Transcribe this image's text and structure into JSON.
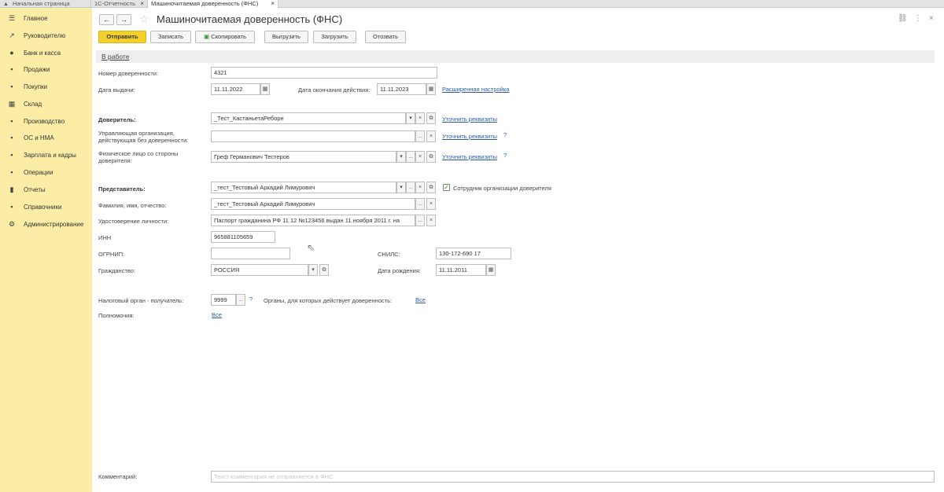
{
  "tabs": {
    "home": "Начальная страница",
    "reporting": "1С-Отчетность",
    "active": "Машиночитаемая доверенность (ФНС)",
    "close": "×"
  },
  "sidebar": {
    "items": [
      {
        "icon": "☰",
        "label": "Главное"
      },
      {
        "icon": "↗",
        "label": "Руководителю"
      },
      {
        "icon": "●",
        "label": "Банк и касса"
      },
      {
        "icon": "▪",
        "label": "Продажи"
      },
      {
        "icon": "▪",
        "label": "Покупки"
      },
      {
        "icon": "▦",
        "label": "Склад"
      },
      {
        "icon": "▪",
        "label": "Производство"
      },
      {
        "icon": "▪",
        "label": "ОС и НМА"
      },
      {
        "icon": "▪",
        "label": "Зарплата и кадры"
      },
      {
        "icon": "▪",
        "label": "Операции"
      },
      {
        "icon": "▮",
        "label": "Отчеты"
      },
      {
        "icon": "▪",
        "label": "Справочники"
      },
      {
        "icon": "⚙",
        "label": "Администрирование"
      }
    ]
  },
  "header": {
    "back": "←",
    "forward": "→",
    "star": "☆",
    "title": "Машиночитаемая доверенность (ФНС)",
    "link_icon": "⛓",
    "more_icon": "⋮",
    "close_icon": "×"
  },
  "toolbar": {
    "send": "Отправить",
    "save": "Записать",
    "copy": "Скопировать",
    "export": "Выгрузить",
    "import": "Загрузить",
    "revoke": "Отозвать"
  },
  "status": "В работе",
  "form": {
    "number_label": "Номер доверенности:",
    "number_value": "4321",
    "issue_date_label": "Дата выдачи:",
    "issue_date_value": "11.11.2022",
    "end_date_label": "Дата окончания действия:",
    "end_date_value": "11.11.2023",
    "advanced_link": "Расширенная настройка",
    "principal_label": "Доверитель:",
    "principal_value": "_Тест_КастаньетаРеборн",
    "clarify_link": "Уточнить реквизиты",
    "mgmt_org_label_1": "Управляющая организация,",
    "mgmt_org_label_2": "действующая без доверенности:",
    "mgmt_org_value": "",
    "individual_label_1": "Физическое лицо со стороны",
    "individual_label_2": "доверителя:",
    "individual_value": "Греф Германович Тестеров",
    "help": "?",
    "representative_label": "Представитель:",
    "representative_value": "_тест_Тестовый Аркадий Лимурович",
    "employee_checkbox_label": "Сотрудник организации доверителя",
    "fio_label": "Фамилия, имя, отчество:",
    "fio_value": "_тест_Тестовый Аркадий Лимурович",
    "id_doc_label": "Удостоверение личности:",
    "id_doc_value": "Паспорт гражданина РФ 11 12 №123456 выдан 11 ноября 2011 г. на",
    "inn_label": "ИНН",
    "inn_value": "965881105659",
    "ogrnip_label": "ОГРНИП:",
    "ogrnip_value": "",
    "snils_label": "СНИЛС:",
    "snils_value": "130-172-690 17",
    "citizenship_label": "Гражданство:",
    "citizenship_value": "РОССИЯ",
    "birth_date_label": "Дата рождения:",
    "birth_date_value": "11.11.2011",
    "tax_authority_label": "Налоговый орган - получатель:",
    "tax_authority_value": "9999",
    "organs_label": "Органы, для которых действует доверенность:",
    "organs_link": "Все",
    "powers_label": "Полномочия:",
    "powers_link": "Все",
    "comment_label": "Комментарий:",
    "comment_placeholder": "Текст комментария не отправляется в ФНС"
  },
  "glyphs": {
    "dropdown": "▾",
    "clear": "×",
    "open": "⧉",
    "select": "...",
    "calendar": "▦",
    "check": "✓",
    "cursor": "⇖"
  }
}
